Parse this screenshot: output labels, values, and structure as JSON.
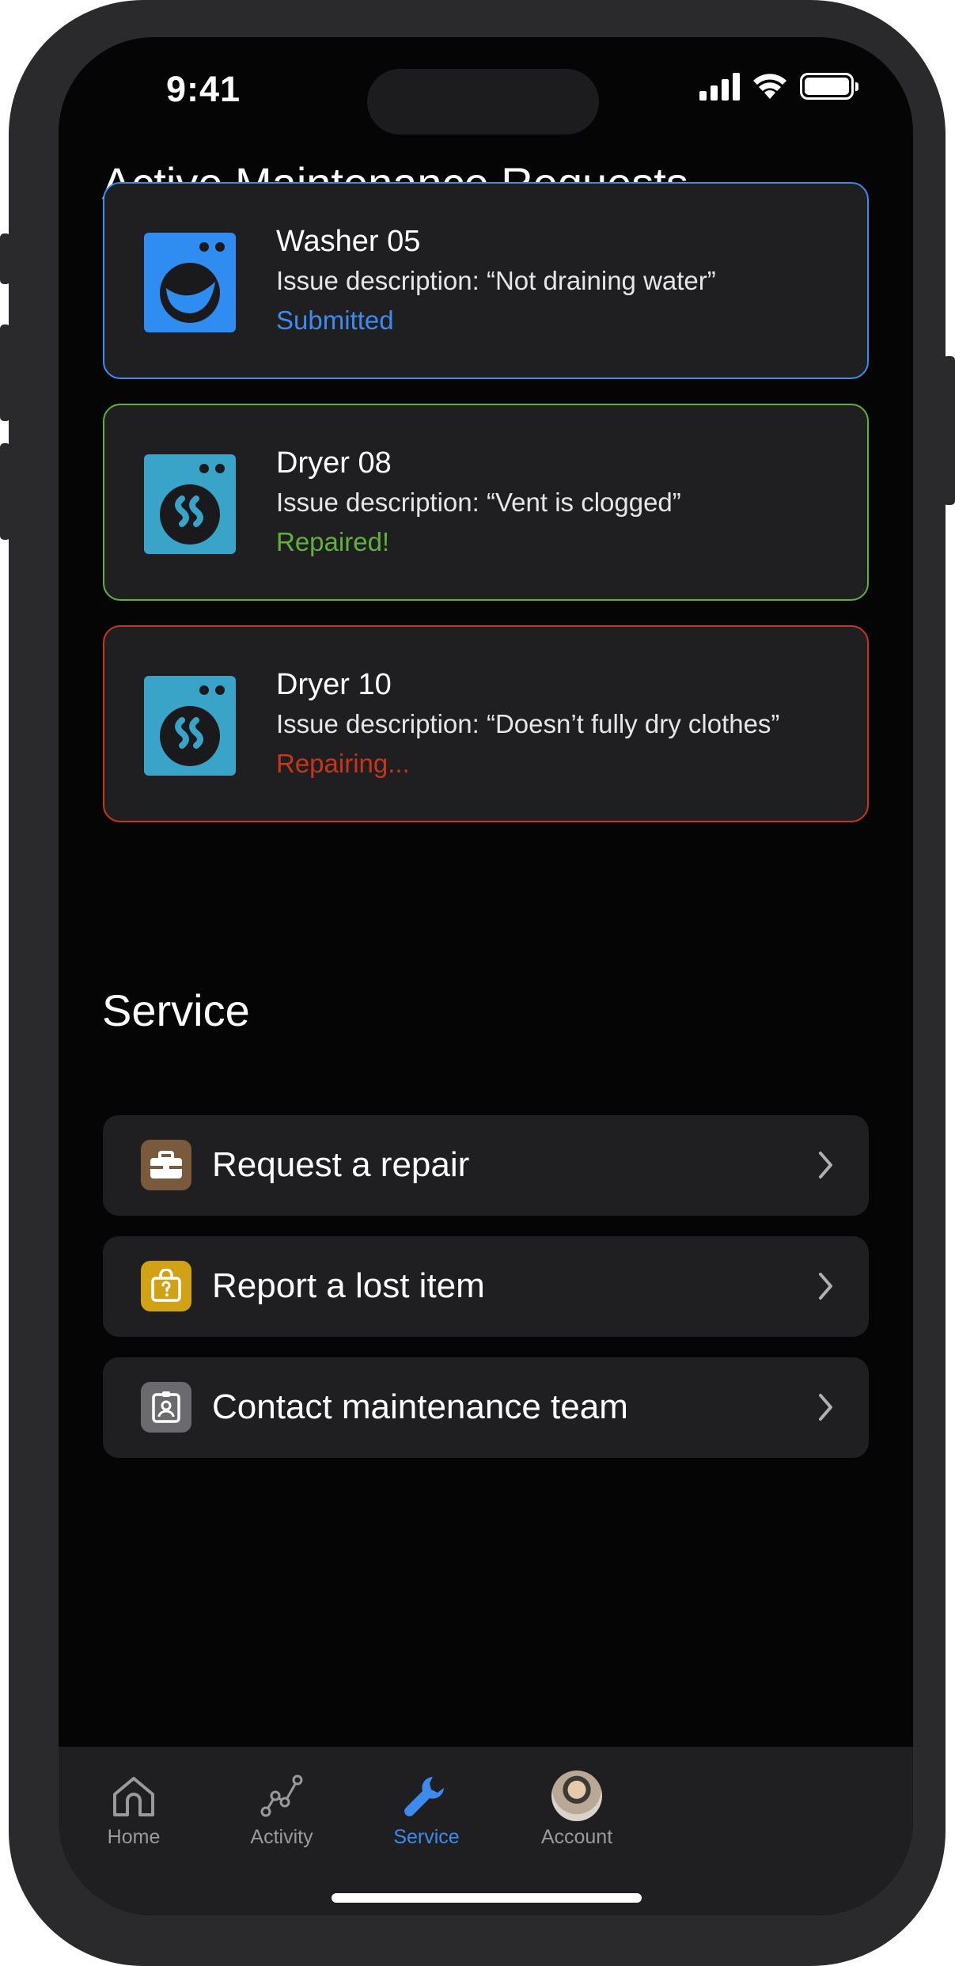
{
  "status_bar": {
    "time": "9:41"
  },
  "active": {
    "title": "Active Maintenance Requests",
    "requests": [
      {
        "name": "Washer 05",
        "description": "Issue description: “Not draining water”",
        "status": "Submitted",
        "status_color": "#3d8bef",
        "border_color": "#3d8bef",
        "icon": "washer-icon"
      },
      {
        "name": "Dryer 08",
        "description": "Issue description: “Vent is clogged”",
        "status": "Repaired!",
        "status_color": "#5fb13a",
        "border_color": "#5fb13a",
        "icon": "dryer-icon"
      },
      {
        "name": "Dryer 10",
        "description": "Issue description: “Doesn’t fully dry clothes”",
        "status": "Repairing...",
        "status_color": "#c8351a",
        "border_color": "#c8351a",
        "icon": "dryer-icon"
      }
    ]
  },
  "service": {
    "title": "Service",
    "items": [
      {
        "label": "Request a repair",
        "icon": "toolbox-icon",
        "icon_bg": "#7a5a3c"
      },
      {
        "label": "Report a lost item",
        "icon": "lost-item-bag-icon",
        "icon_bg": "#d1a216"
      },
      {
        "label": "Contact maintenance team",
        "icon": "contact-badge-icon",
        "icon_bg": "#6b6b6f"
      }
    ]
  },
  "tabbar": {
    "tabs": [
      {
        "label": "Home",
        "icon": "home-icon",
        "active": false
      },
      {
        "label": "Activity",
        "icon": "activity-icon",
        "active": false
      },
      {
        "label": "Service",
        "icon": "wrench-icon",
        "active": true
      },
      {
        "label": "Account",
        "icon": "avatar",
        "active": false
      }
    ]
  },
  "colors": {
    "accent": "#3d8bef",
    "background": "#050505",
    "card": "#1f1f21"
  }
}
